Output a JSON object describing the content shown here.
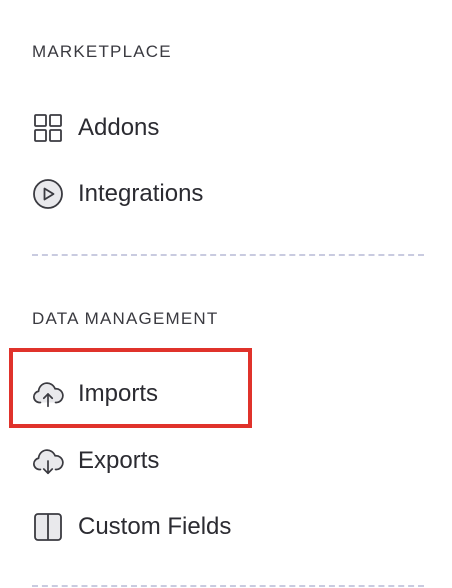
{
  "sections": {
    "marketplace": {
      "heading": "MARKETPLACE",
      "items": [
        {
          "label": "Addons",
          "icon": "grid-icon"
        },
        {
          "label": "Integrations",
          "icon": "play-circle-icon"
        }
      ]
    },
    "data_management": {
      "heading": "DATA MANAGEMENT",
      "items": [
        {
          "label": "Imports",
          "icon": "cloud-upload-icon"
        },
        {
          "label": "Exports",
          "icon": "cloud-download-icon"
        },
        {
          "label": "Custom Fields",
          "icon": "columns-icon"
        }
      ]
    }
  },
  "colors": {
    "text": "#2b2b31",
    "icon": "#3a3a40",
    "divider": "#c9cbe0",
    "highlight": "#e0322b"
  }
}
